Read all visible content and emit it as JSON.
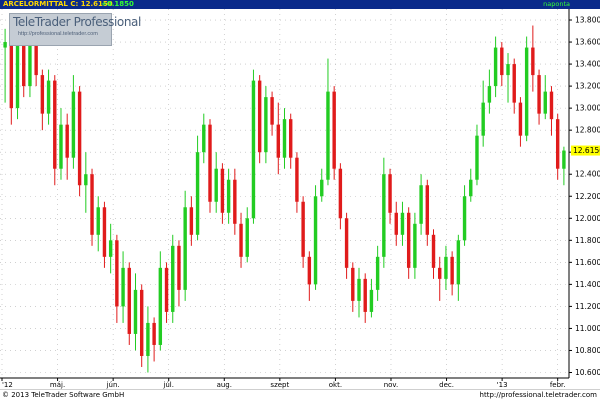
{
  "header": {
    "symbol_price": "ARCELORMITTAL C: 12.6150",
    "change": "+0.1850",
    "period": "naponta"
  },
  "watermark": {
    "brand": "TeleTrader Professional",
    "url": "http://professional.teletrader.com"
  },
  "footer": {
    "copyright": "© 2013 TeleTrader Software GmbH",
    "url": "http://professional.teletrader.com"
  },
  "colors": {
    "up": "#22cc22",
    "down": "#e01b1b",
    "header_bg": "#0a2a8a",
    "price_tag": "#ffff00"
  },
  "chart_data": {
    "type": "candlestick",
    "y_ticks": [
      "13.8000",
      "13.6000",
      "13.4000",
      "13.2000",
      "13.0000",
      "12.8000",
      "12.6000",
      "12.4000",
      "12.2000",
      "12.0000",
      "11.8000",
      "11.6000",
      "11.4000",
      "11.2000",
      "11.0000",
      "10.8000",
      "10.6000"
    ],
    "ylim": [
      10.55,
      13.9
    ],
    "x_ticks": [
      "'12",
      "máj.",
      "jún.",
      "júl.",
      "aug.",
      "szept",
      "okt.",
      "nov.",
      "dec.",
      "'13",
      "febr."
    ],
    "last_price_label": "12.6150",
    "last_price": 12.615,
    "candles_start_month": 4,
    "candles": [
      [
        13.55,
        13.72,
        13.05,
        13.6
      ],
      [
        13.6,
        13.65,
        12.85,
        13.0
      ],
      [
        13.0,
        13.7,
        12.9,
        13.6
      ],
      [
        13.6,
        13.7,
        13.1,
        13.2
      ],
      [
        13.2,
        13.85,
        13.1,
        13.78
      ],
      [
        13.78,
        13.82,
        13.2,
        13.3
      ],
      [
        13.3,
        13.35,
        12.8,
        12.95
      ],
      [
        12.95,
        13.35,
        12.85,
        13.25
      ],
      [
        13.25,
        13.3,
        12.3,
        12.45
      ],
      [
        12.45,
        13.0,
        12.35,
        12.85
      ],
      [
        12.85,
        12.95,
        12.35,
        12.55
      ],
      [
        12.55,
        13.3,
        12.45,
        13.15
      ],
      [
        13.15,
        13.2,
        12.2,
        12.3
      ],
      [
        12.3,
        12.6,
        12.05,
        12.4
      ],
      [
        12.4,
        12.45,
        11.75,
        11.85
      ],
      [
        11.85,
        12.2,
        11.7,
        12.1
      ],
      [
        12.1,
        12.15,
        11.55,
        11.65
      ],
      [
        11.65,
        11.95,
        11.5,
        11.8
      ],
      [
        11.8,
        11.85,
        11.05,
        11.2
      ],
      [
        11.2,
        11.7,
        11.05,
        11.55
      ],
      [
        11.55,
        11.6,
        10.85,
        10.95
      ],
      [
        10.95,
        11.5,
        10.8,
        11.35
      ],
      [
        11.35,
        11.4,
        10.65,
        10.75
      ],
      [
        10.75,
        11.2,
        10.6,
        11.05
      ],
      [
        11.05,
        11.1,
        10.7,
        10.85
      ],
      [
        10.85,
        11.7,
        10.8,
        11.55
      ],
      [
        11.55,
        11.6,
        11.05,
        11.15
      ],
      [
        11.15,
        11.85,
        11.05,
        11.75
      ],
      [
        11.75,
        11.8,
        11.2,
        11.35
      ],
      [
        11.35,
        12.25,
        11.25,
        12.1
      ],
      [
        12.1,
        12.2,
        11.75,
        11.85
      ],
      [
        11.85,
        12.75,
        11.8,
        12.6
      ],
      [
        12.6,
        12.95,
        12.5,
        12.85
      ],
      [
        12.85,
        12.9,
        12.05,
        12.15
      ],
      [
        12.15,
        12.6,
        12.05,
        12.45
      ],
      [
        12.45,
        12.5,
        11.95,
        12.05
      ],
      [
        12.05,
        12.45,
        11.95,
        12.35
      ],
      [
        12.35,
        12.45,
        11.85,
        11.95
      ],
      [
        11.95,
        12.05,
        11.55,
        11.65
      ],
      [
        11.65,
        12.1,
        11.6,
        12.0
      ],
      [
        12.0,
        13.35,
        11.95,
        13.25
      ],
      [
        13.25,
        13.3,
        12.5,
        12.6
      ],
      [
        12.6,
        13.2,
        12.5,
        13.1
      ],
      [
        13.1,
        13.15,
        12.75,
        12.85
      ],
      [
        12.85,
        13.05,
        12.4,
        12.55
      ],
      [
        12.55,
        13.0,
        12.45,
        12.9
      ],
      [
        12.9,
        12.95,
        12.45,
        12.55
      ],
      [
        12.55,
        12.6,
        12.05,
        12.15
      ],
      [
        12.15,
        12.2,
        11.55,
        11.65
      ],
      [
        11.65,
        11.7,
        11.25,
        11.4
      ],
      [
        11.4,
        12.3,
        11.35,
        12.2
      ],
      [
        12.2,
        12.45,
        12.15,
        12.35
      ],
      [
        12.35,
        13.45,
        12.3,
        13.15
      ],
      [
        13.15,
        13.2,
        12.35,
        12.45
      ],
      [
        12.45,
        12.5,
        11.9,
        12.0
      ],
      [
        12.0,
        12.05,
        11.45,
        11.55
      ],
      [
        11.55,
        11.6,
        11.15,
        11.25
      ],
      [
        11.25,
        11.55,
        11.1,
        11.45
      ],
      [
        11.45,
        11.5,
        11.05,
        11.15
      ],
      [
        11.15,
        11.45,
        11.1,
        11.35
      ],
      [
        11.35,
        11.75,
        11.25,
        11.65
      ],
      [
        11.65,
        12.55,
        11.55,
        12.4
      ],
      [
        12.4,
        12.45,
        11.95,
        12.05
      ],
      [
        12.05,
        12.15,
        11.75,
        11.85
      ],
      [
        11.85,
        12.15,
        11.75,
        12.05
      ],
      [
        12.05,
        12.1,
        11.45,
        11.55
      ],
      [
        11.55,
        12.05,
        11.45,
        11.95
      ],
      [
        11.95,
        12.4,
        11.85,
        12.3
      ],
      [
        12.3,
        12.35,
        11.75,
        11.85
      ],
      [
        11.85,
        11.9,
        11.45,
        11.55
      ],
      [
        11.55,
        11.65,
        11.25,
        11.45
      ],
      [
        11.45,
        11.75,
        11.35,
        11.65
      ],
      [
        11.65,
        11.7,
        11.3,
        11.4
      ],
      [
        11.4,
        11.85,
        11.25,
        11.8
      ],
      [
        11.8,
        12.3,
        11.75,
        12.2
      ],
      [
        12.2,
        12.45,
        12.15,
        12.35
      ],
      [
        12.35,
        12.85,
        12.3,
        12.75
      ],
      [
        12.75,
        13.25,
        12.65,
        13.05
      ],
      [
        13.05,
        13.35,
        12.95,
        13.2
      ],
      [
        13.2,
        13.65,
        13.1,
        13.55
      ],
      [
        13.55,
        13.6,
        13.2,
        13.3
      ],
      [
        13.3,
        13.5,
        13.05,
        13.4
      ],
      [
        13.4,
        13.45,
        12.95,
        13.05
      ],
      [
        13.05,
        13.1,
        12.65,
        12.75
      ],
      [
        12.75,
        13.65,
        12.7,
        13.55
      ],
      [
        13.55,
        13.75,
        13.15,
        13.3
      ],
      [
        13.3,
        13.35,
        12.85,
        12.95
      ],
      [
        12.95,
        13.3,
        12.9,
        13.15
      ],
      [
        13.15,
        13.2,
        12.75,
        12.9
      ],
      [
        12.9,
        12.95,
        12.35,
        12.45
      ],
      [
        12.45,
        12.65,
        12.3,
        12.615
      ]
    ]
  }
}
